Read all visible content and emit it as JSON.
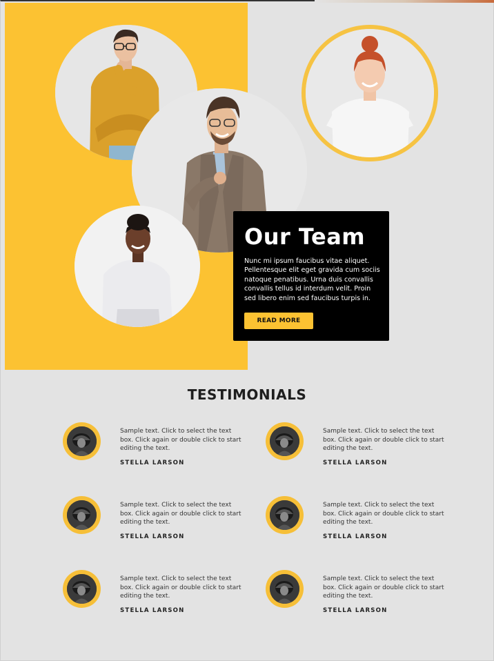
{
  "team": {
    "title": "Our Team",
    "body": "Nunc mi ipsum faucibus vitae aliquet. Pellentesque elit eget gravida cum sociis natoque penatibus. Urna duis convallis convallis tellus id interdum velit. Proin sed libero enim sed faucibus turpis in.",
    "button_label": "READ MORE"
  },
  "testimonials": {
    "title": "TESTIMONIALS",
    "items": [
      {
        "text": "Sample text. Click to select the text box. Click again or double click to start editing the text.",
        "name": "STELLA LARSON"
      },
      {
        "text": "Sample text. Click to select the text box. Click again or double click to start editing the text.",
        "name": "STELLA LARSON"
      },
      {
        "text": "Sample text. Click to select the text box. Click again or double click to start editing the text.",
        "name": "STELLA LARSON"
      },
      {
        "text": "Sample text. Click to select the text box. Click again or double click to start editing the text.",
        "name": "STELLA LARSON"
      },
      {
        "text": "Sample text. Click to select the text box. Click again or double click to start editing the text.",
        "name": "STELLA LARSON"
      },
      {
        "text": "Sample text. Click to select the text box. Click again or double click to start editing the text.",
        "name": "STELLA LARSON"
      }
    ]
  },
  "colors": {
    "accent": "#fcc232",
    "background": "#e3e3e3",
    "card": "#000000"
  }
}
